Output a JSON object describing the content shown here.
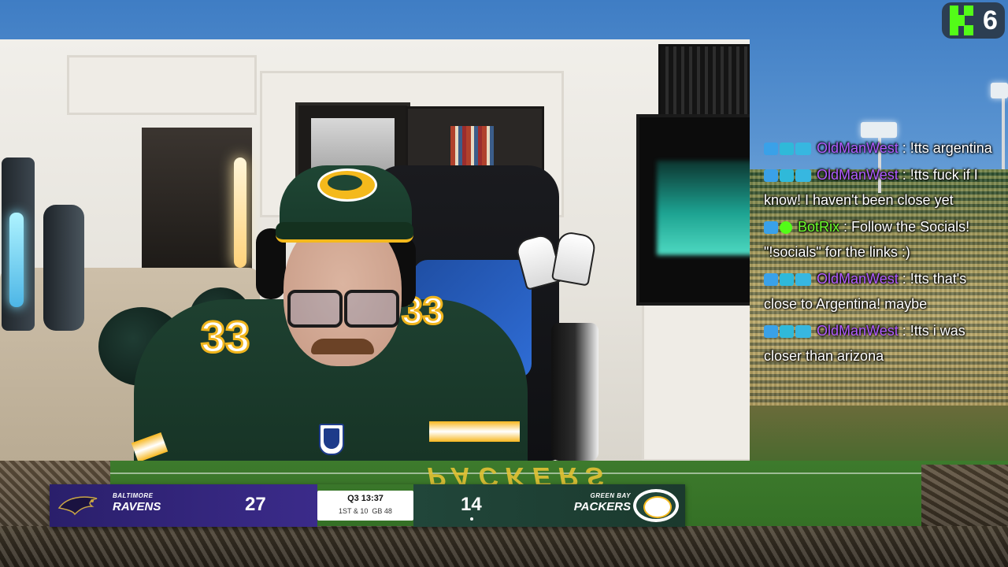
{
  "kick_badge": {
    "count": "6"
  },
  "chat": [
    {
      "username": "OldManWest",
      "color": "#b05bff",
      "badges": [
        "wrench-icon",
        "cube-icon",
        "sub-badge-icon"
      ],
      "message": "!tts argentina"
    },
    {
      "username": "OldManWest",
      "color": "#b05bff",
      "badges": [
        "wrench-icon",
        "cube-icon",
        "sub-badge-icon"
      ],
      "message": "!tts fuck if I know! I haven't been close yet"
    },
    {
      "username": "BotRix",
      "color": "#6cff2b",
      "badges": [
        "wrench-icon",
        "verified-icon"
      ],
      "message": "Follow the Socials! \"!socials\" for the links :)"
    },
    {
      "username": "OldManWest",
      "color": "#b05bff",
      "badges": [
        "wrench-icon",
        "cube-icon",
        "sub-badge-icon"
      ],
      "message": "!tts that's close to Argentina! maybe"
    },
    {
      "username": "OldManWest",
      "color": "#b05bff",
      "badges": [
        "wrench-icon",
        "cube-icon",
        "sub-badge-icon"
      ],
      "message": "!tts i was closer than arizona"
    }
  ],
  "scoreboard": {
    "away": {
      "city": "BALTIMORE",
      "name": "RAVENS",
      "score": "27",
      "color": "#2e2280"
    },
    "home": {
      "city": "GREEN BAY",
      "name": "PACKERS",
      "score": "14",
      "color": "#203f33"
    },
    "clock": "Q3 13:37",
    "down_distance": "1ST & 10",
    "ball_on": "GB 48"
  },
  "field_text": "PACKERS",
  "jersey_number": "33",
  "colors": {
    "kick_green": "#53fc18",
    "packers_gold": "#f4b91c"
  }
}
